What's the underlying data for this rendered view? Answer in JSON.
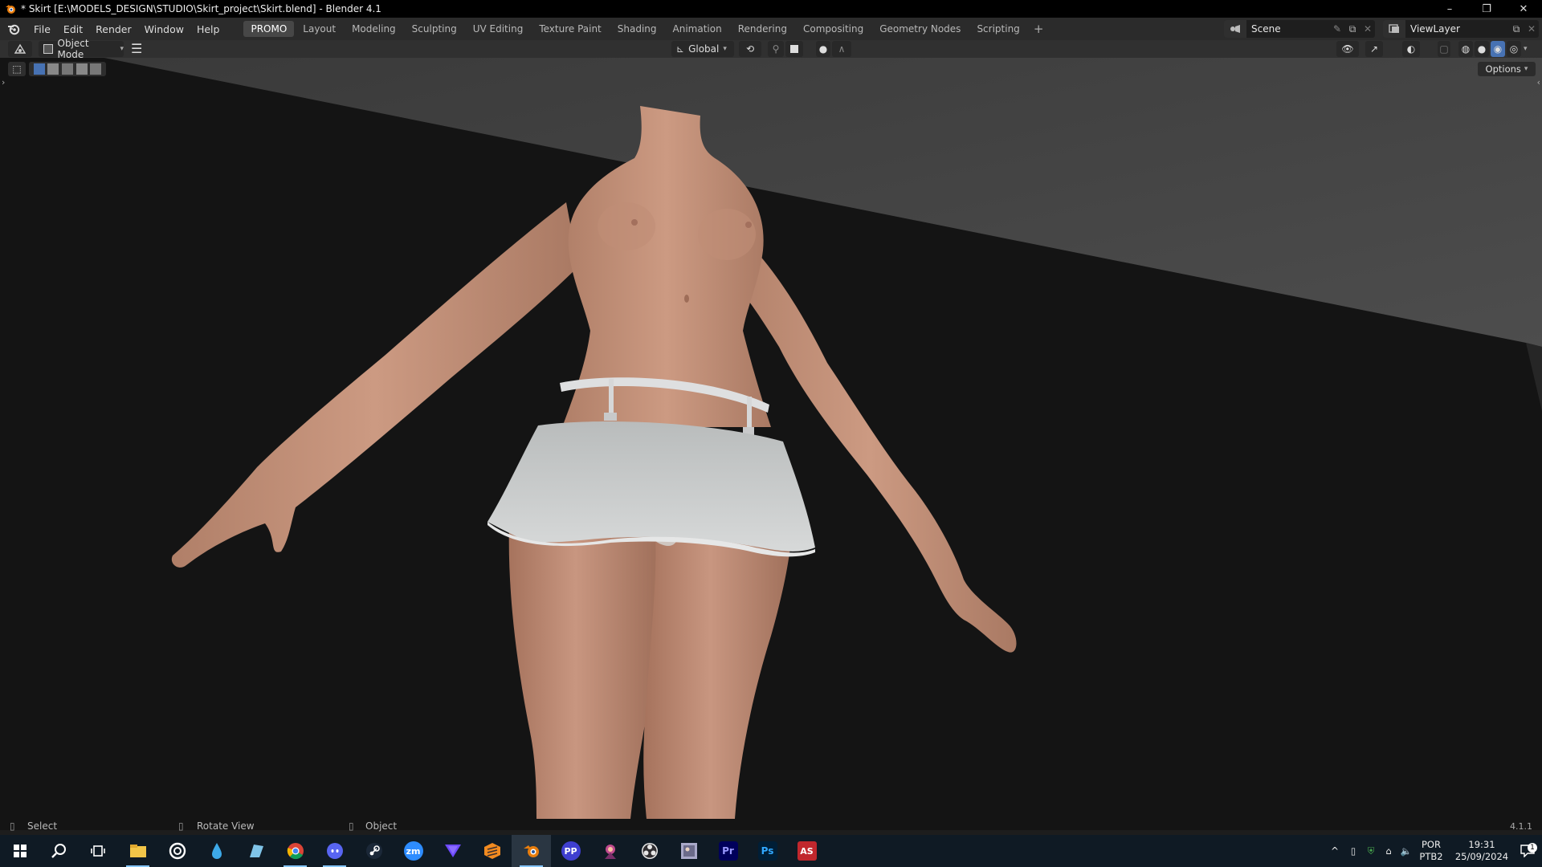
{
  "window": {
    "title": "* Skirt [E:\\MODELS_DESIGN\\STUDIO\\Skirt_project\\Skirt.blend] - Blender 4.1",
    "controls": {
      "minimize": "–",
      "restore": "❐",
      "close": "✕"
    }
  },
  "menu": [
    "File",
    "Edit",
    "Render",
    "Window",
    "Help"
  ],
  "workspaces": {
    "tabs": [
      "PROMO",
      "Layout",
      "Modeling",
      "Sculpting",
      "UV Editing",
      "Texture Paint",
      "Shading",
      "Animation",
      "Rendering",
      "Compositing",
      "Geometry Nodes",
      "Scripting"
    ],
    "active_index": 0,
    "add": "+"
  },
  "scene": {
    "name": "Scene"
  },
  "view_layer": {
    "name": "ViewLayer"
  },
  "header": {
    "mode": "Object Mode",
    "orientation": "Global",
    "options": "Options"
  },
  "status": {
    "left_click": "Select",
    "middle_click": "Rotate View",
    "right_click": "Object",
    "version": "4.1.1"
  },
  "taskbar": {
    "apps": [
      "windows-start",
      "search",
      "task-view",
      "file-explorer",
      "davinci-resolve",
      "ink-drop",
      "notes",
      "chrome",
      "discord",
      "steam",
      "zoom",
      "proton-vpn",
      "sublime",
      "blender",
      "pp",
      "game",
      "obs",
      "photo",
      "premiere-pro",
      "photoshop",
      "as"
    ],
    "labels": {
      "zoom": "zm",
      "pp": "PP",
      "premiere": "Pr",
      "photoshop": "Ps",
      "as": "AS"
    },
    "lang_top": "POR",
    "lang_bottom": "PTB2",
    "time": "19:31",
    "date": "25/09/2024",
    "notifications": "1"
  },
  "colors": {
    "accent": "#4772b3",
    "skin": "#c7957c",
    "skirt": "#c9cbcb",
    "floor": "#4a4a4a",
    "background": "#141414"
  }
}
